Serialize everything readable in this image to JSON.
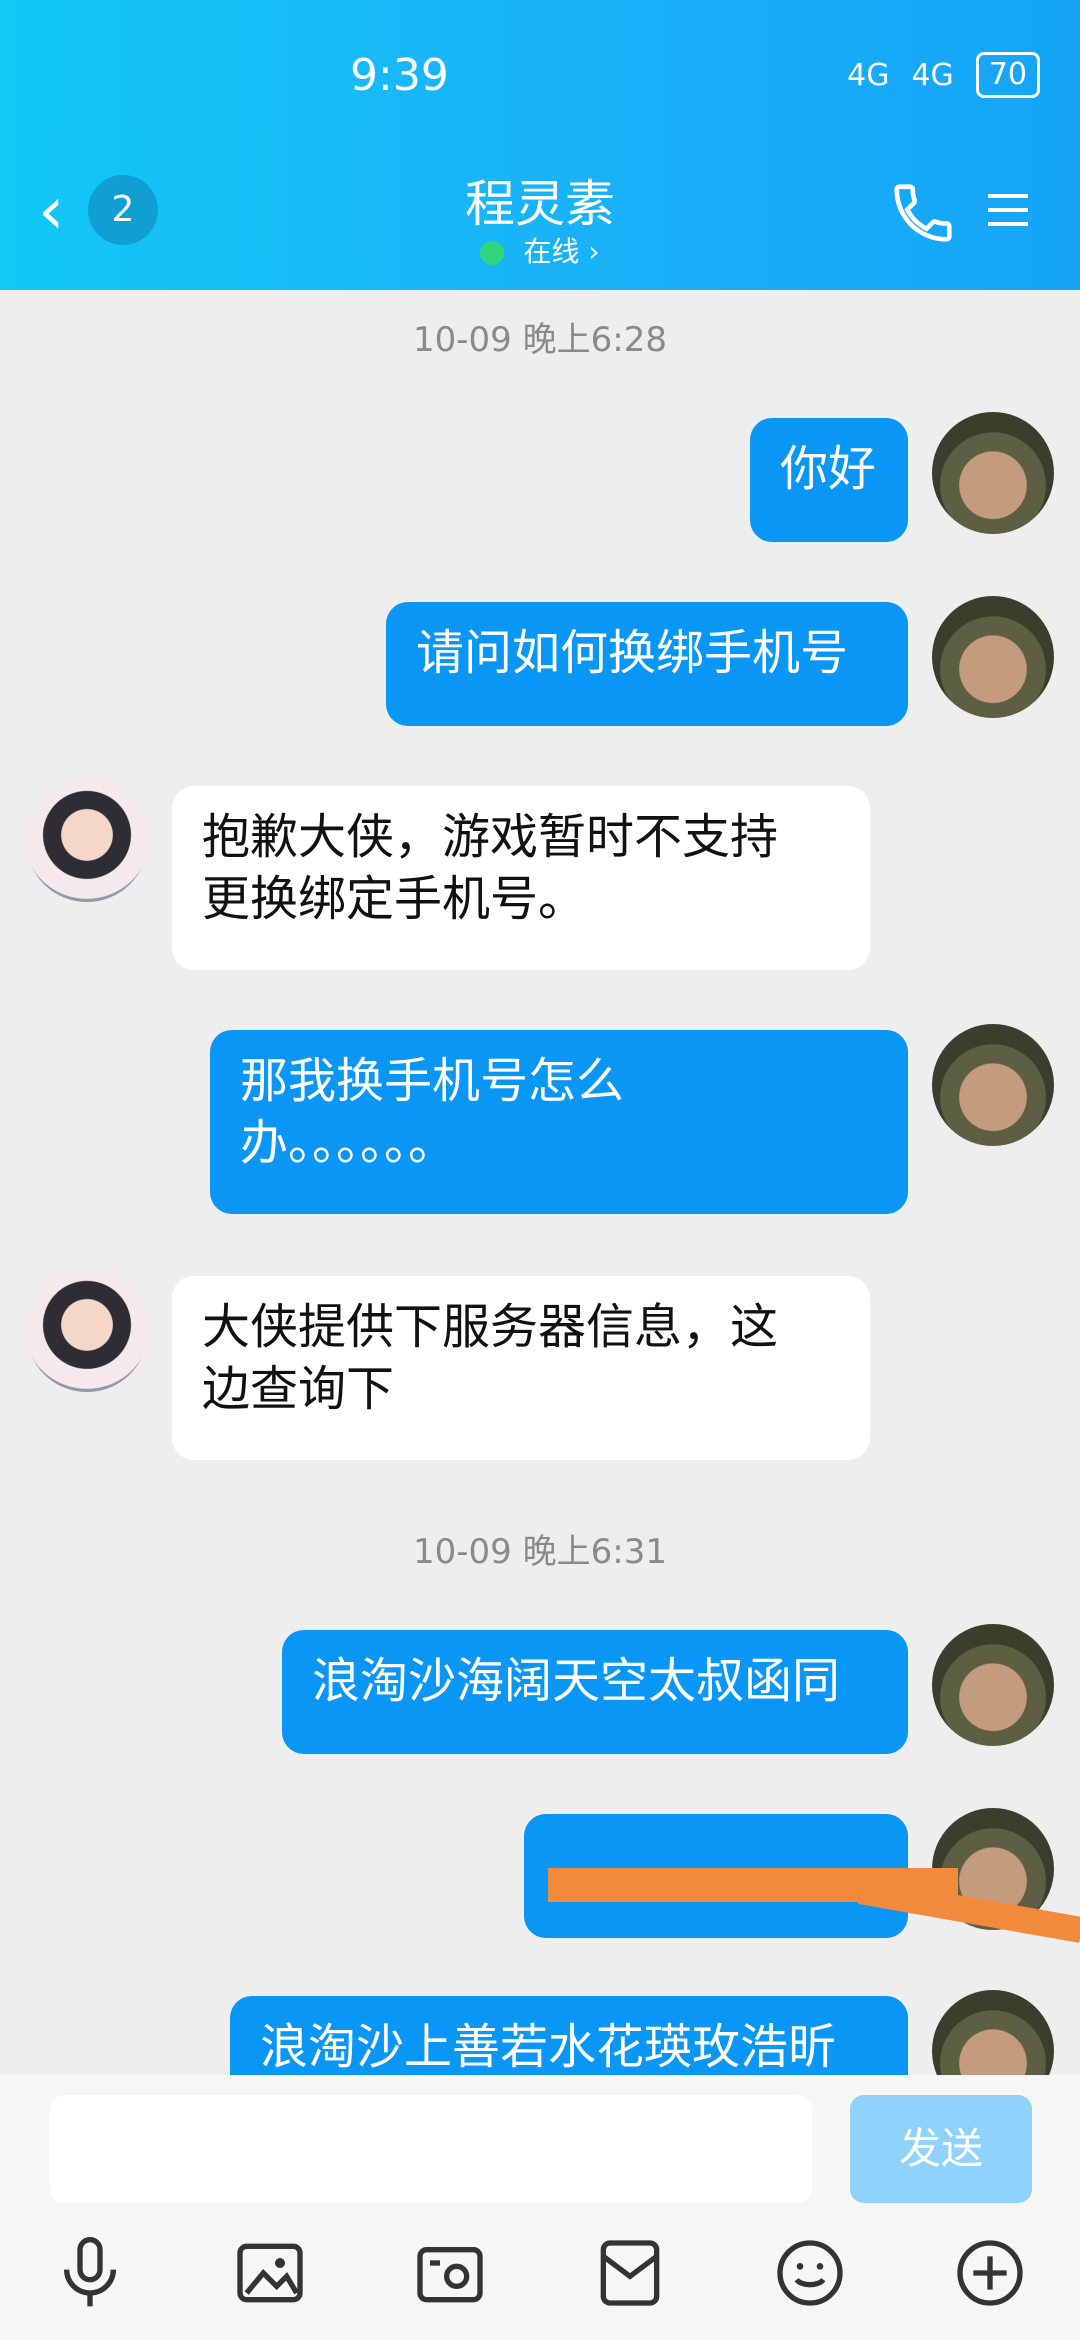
{
  "status": {
    "time": "9:39",
    "net1": "4G",
    "net2": "4G",
    "battery": "70"
  },
  "header": {
    "back_count": "2",
    "title": "程灵素",
    "status": "在线",
    "status_color": "#2fd67b"
  },
  "chat": {
    "timestamp1": "10-09 晚上6:28",
    "timestamp2": "10-09 晚上6:31",
    "messages": [
      {
        "side": "sent",
        "text": "你好"
      },
      {
        "side": "sent",
        "text": "请问如何换绑手机号"
      },
      {
        "side": "received",
        "line1": "抱歉大侠，游戏暂时不支持",
        "line2": "更换绑定手机号。"
      },
      {
        "side": "sent",
        "line1": "那我换手机号怎么",
        "line2": "办。。。。。。"
      },
      {
        "side": "received",
        "line1": "大侠提供下服务器信息，这",
        "line2": "边查询下"
      },
      {
        "side": "sent",
        "text": "浪淘沙海阔天空太叔函同"
      },
      {
        "side": "sent",
        "text": ""
      },
      {
        "side": "sent",
        "text": "浪淘沙上善若水花瑛玫浩昕"
      }
    ]
  },
  "input": {
    "placeholder": "",
    "send_label": "发送"
  },
  "toolbar": [
    "microphone-icon",
    "image-icon",
    "camera-icon",
    "red-packet-icon",
    "emoji-icon",
    "plus-icon"
  ],
  "colors": {
    "header": "#19b3f8",
    "sent_bubble": "#0a96f5",
    "received_bubble": "#ffffff",
    "send_button": "#8fd2fb"
  }
}
